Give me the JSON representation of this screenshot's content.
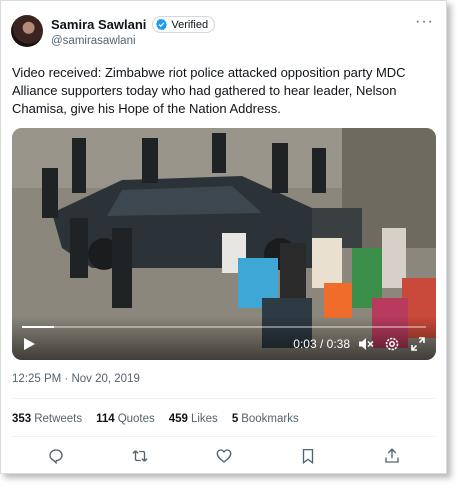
{
  "author": {
    "display_name": "Samira Sawlani",
    "verified_label": "Verified",
    "handle": "@samirasawlani"
  },
  "tweet": {
    "text": "Video received: Zimbabwe riot police attacked opposition party MDC Alliance supporters today who had gathered to hear leader, Nelson Chamisa, give his Hope of the Nation Address.",
    "timestamp": "12:25 PM · Nov 20, 2019"
  },
  "video": {
    "time": "0:03 / 0:38",
    "progress_fraction": 0.079
  },
  "stats": [
    {
      "count": "353",
      "label": "Retweets"
    },
    {
      "count": "114",
      "label": "Quotes"
    },
    {
      "count": "459",
      "label": "Likes"
    },
    {
      "count": "5",
      "label": "Bookmarks"
    }
  ],
  "icons": {
    "more": "more-icon",
    "verified": "verified-badge-icon",
    "reply": "reply-icon",
    "retweet": "retweet-icon",
    "like": "heart-icon",
    "bookmark": "bookmark-icon",
    "share": "share-icon"
  },
  "colors": {
    "verified_blue": "#1d9bf0",
    "text_secondary": "#536471"
  }
}
